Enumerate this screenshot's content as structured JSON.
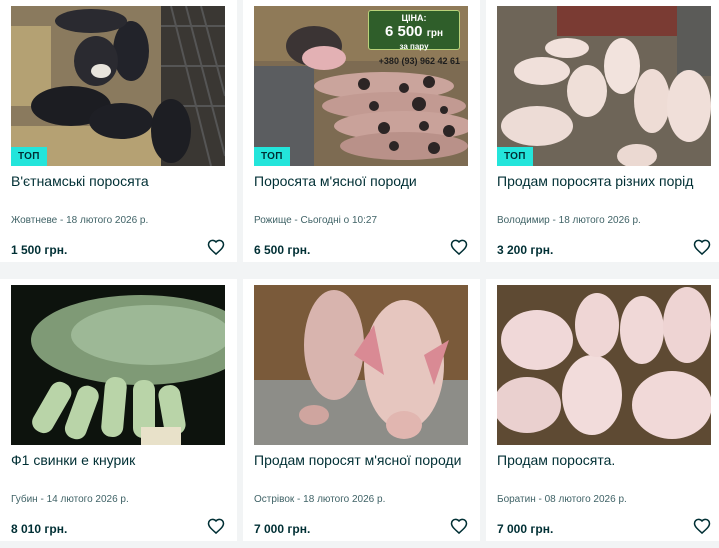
{
  "listings": [
    {
      "title": "В'єтнамські поросята",
      "location": "Жовтневе",
      "date": "18 лютого 2026 р.",
      "price": "1 500 грн.",
      "badge": "ТОП"
    },
    {
      "title": "Поросята м'ясної породи",
      "location": "Рожище",
      "date": "Сьогодні о 10:27",
      "price": "6 500 грн.",
      "badge": "ТОП",
      "image_overlay": {
        "label": "ЦІНА:",
        "amount": "6 500",
        "currency": "грн",
        "note": "за пару",
        "phone": "+380 (93) 962 42 61"
      }
    },
    {
      "title": "Продам поросята різних порід",
      "location": "Володимир",
      "date": "18 лютого 2026 р.",
      "price": "3 200 грн.",
      "badge": "ТОП"
    },
    {
      "title": "Ф1 свинки е кнурик",
      "location": "Губин",
      "date": "14 лютого 2026 р.",
      "price": "8 010 грн."
    },
    {
      "title": "Продам поросят м'ясної породи",
      "location": "Острівок",
      "date": "18 лютого 2026 р.",
      "price": "7 000 грн."
    },
    {
      "title": "Продам поросята.",
      "location": "Боратин",
      "date": "08 лютого 2026 р.",
      "price": "7 000 грн."
    }
  ],
  "meta_separator": " - ",
  "icons": {
    "favorite": "heart-outline-icon"
  },
  "colors": {
    "badge": "#23e5db",
    "text": "#002f34",
    "muted": "#406367",
    "background": "#f2f4f5"
  }
}
